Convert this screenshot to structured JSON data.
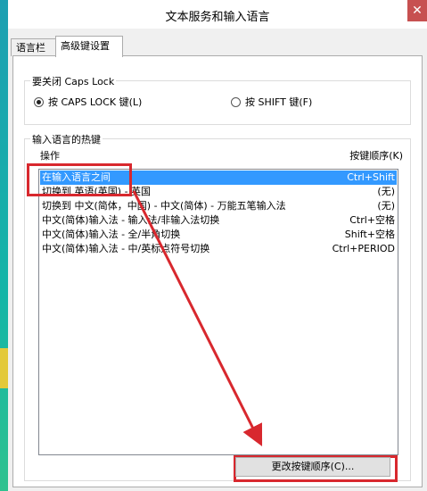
{
  "window": {
    "title": "文本服务和输入语言",
    "close_glyph": "✕"
  },
  "tabs": [
    {
      "label": "语言栏",
      "active": false
    },
    {
      "label": "高级键设置",
      "active": true
    }
  ],
  "caps_group": {
    "legend": "要关闭 Caps Lock",
    "options": [
      {
        "label": "按 CAPS LOCK 键(L)",
        "selected": true
      },
      {
        "label": "按 SHIFT 键(F)",
        "selected": false
      }
    ]
  },
  "hotkey_group": {
    "legend": "输入语言的热键",
    "col_action": "操作",
    "col_keys": "按键顺序(K)",
    "rows": [
      {
        "action": "在输入语言之间",
        "keys": "Ctrl+Shift",
        "selected": true
      },
      {
        "action": "切换到 英语(英国) - 英国",
        "keys": "(无)",
        "selected": false
      },
      {
        "action": "切换到 中文(简体，中国) - 中文(简体) - 万能五笔输入法",
        "keys": "(无)",
        "selected": false
      },
      {
        "action": "中文(简体)输入法 - 输入法/非输入法切换",
        "keys": "Ctrl+空格",
        "selected": false
      },
      {
        "action": "中文(简体)输入法 - 全/半角切换",
        "keys": "Shift+空格",
        "selected": false
      },
      {
        "action": "中文(简体)输入法 - 中/英标点符号切换",
        "keys": "Ctrl+PERIOD",
        "selected": false
      }
    ],
    "change_button": "更改按键顺序(C)..."
  },
  "colors": {
    "selection": "#3399ff",
    "annotation": "#d8282e"
  }
}
